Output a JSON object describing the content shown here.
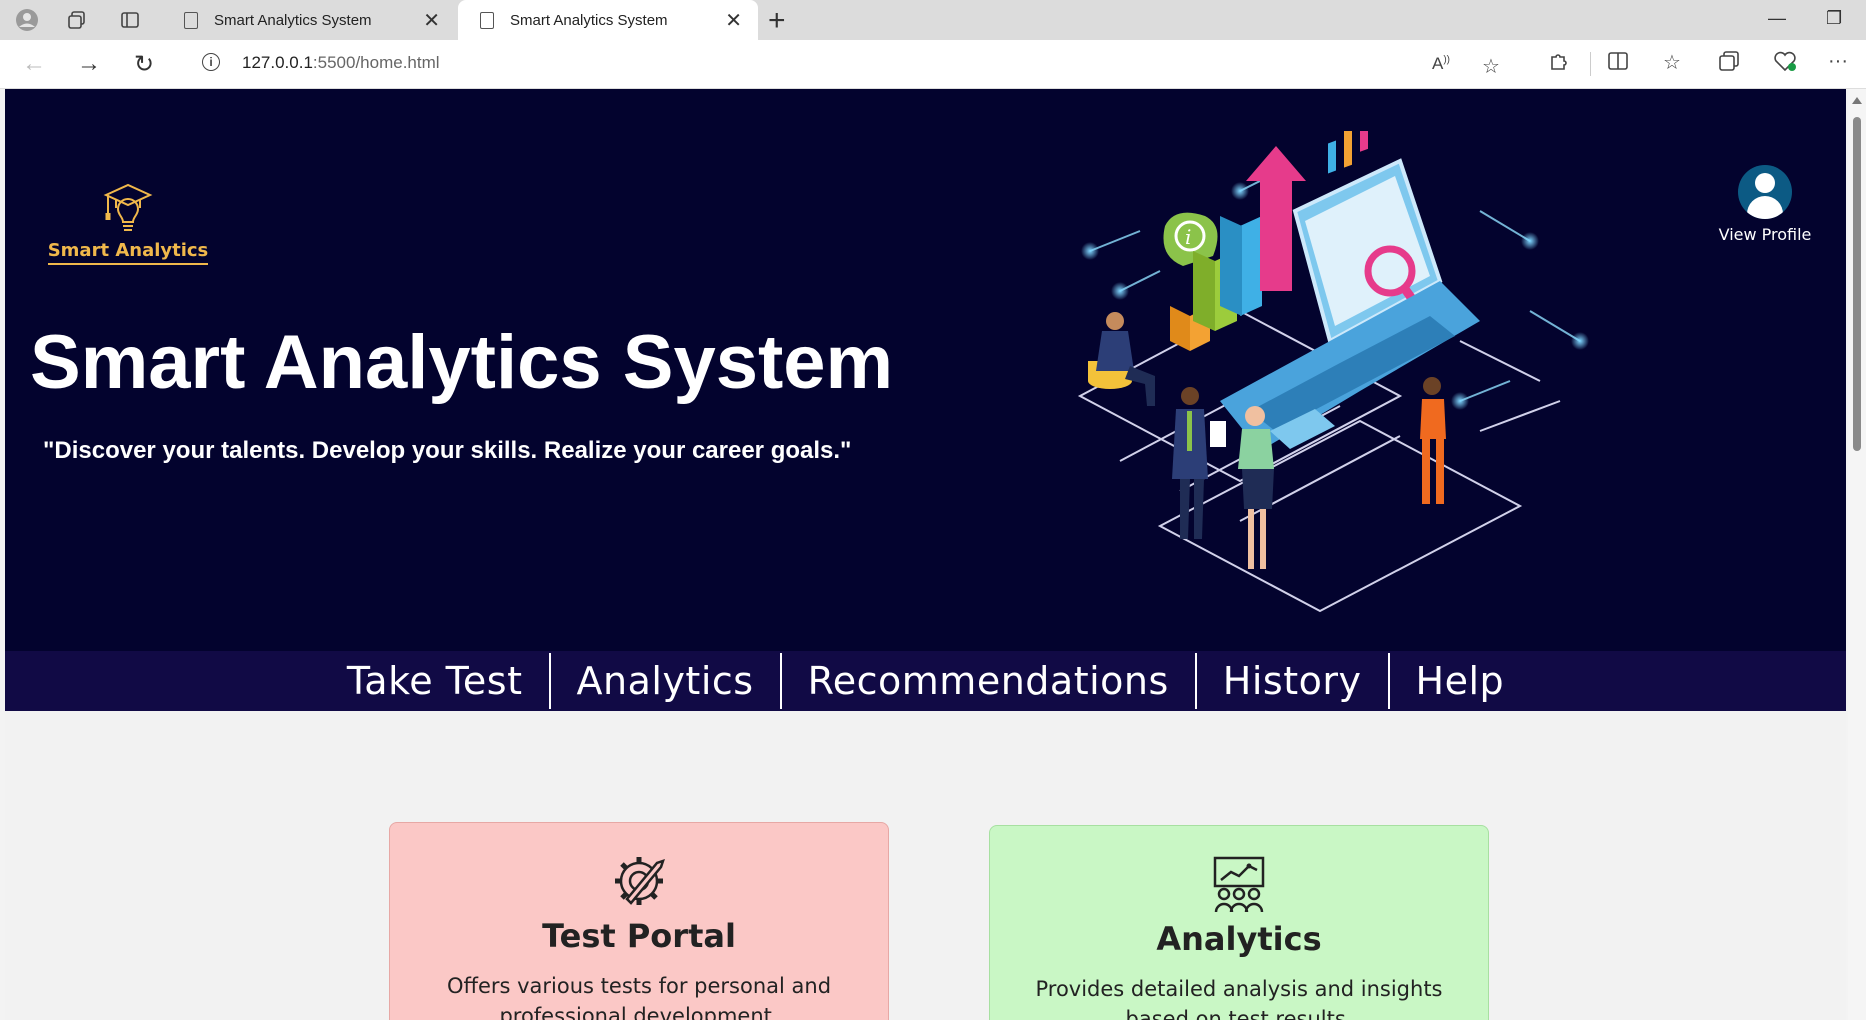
{
  "browser": {
    "tabs": [
      {
        "title": "Smart Analytics System",
        "active": false
      },
      {
        "title": "Smart Analytics System",
        "active": true
      }
    ],
    "url_host": "127.0.0.1",
    "url_rest": ":5500/home.html"
  },
  "hero": {
    "logo_text": "Smart Analytics",
    "title": "Smart Analytics System",
    "tagline": "\"Discover your talents. Develop your skills. Realize your career goals.\"",
    "profile_label": "View Profile"
  },
  "nav": {
    "items": [
      "Take Test",
      "Analytics",
      "Recommendations",
      "History",
      "Help"
    ]
  },
  "cards": {
    "test_portal": {
      "title": "Test Portal",
      "description": "Offers various tests for personal and professional development."
    },
    "analytics": {
      "title": "Analytics",
      "description": "Provides detailed analysis and insights based on test results."
    }
  },
  "colors": {
    "hero_bg": "#03032e",
    "nav_bg": "#110a45",
    "logo_gold": "#f0b84b",
    "card_test_bg": "#fbc8c6",
    "card_analytics_bg": "#c9f7c5"
  }
}
